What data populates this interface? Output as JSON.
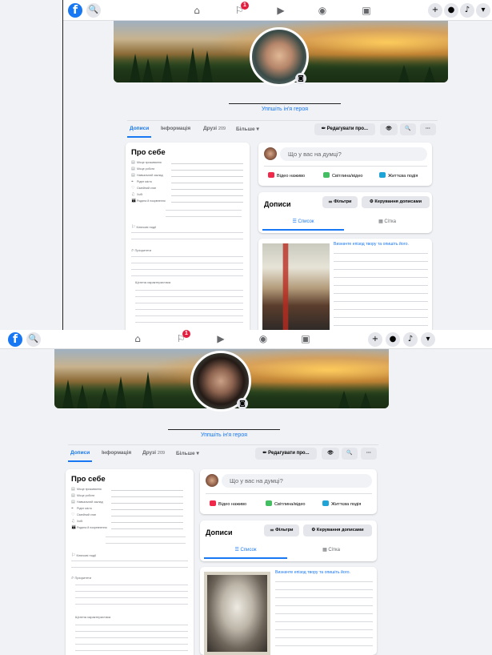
{
  "topbar": {
    "logo_letter": "f",
    "search_icon": "🔍",
    "notifications_badge": "1"
  },
  "profile": {
    "hero_name_link": "Уппшіть ін'я героя"
  },
  "tabs": {
    "posts": "Дописи",
    "info": "Інформація",
    "friends": "Друзі",
    "friends_count": "209",
    "more": "Більше ▾",
    "edit_profile": "✏ Редагувати про...",
    "view_icon": "👁",
    "search_icon": "🔍",
    "more_icon": "···"
  },
  "about": {
    "title": "Про себе",
    "rows": [
      {
        "icon": "▤",
        "label": "Місце проживання"
      },
      {
        "icon": "▤",
        "label": "Місце роботи"
      },
      {
        "icon": "▤",
        "label": "Навчальний заклад"
      },
      {
        "icon": "⌖",
        "label": "Рідне місто"
      },
      {
        "icon": "♡",
        "label": "Сімейний стан"
      },
      {
        "icon": "♫",
        "label": "Хобі"
      },
      {
        "icon": "👪",
        "label": "Родина й покрвнення"
      }
    ],
    "life_events": "Ключові події",
    "preferences": "Пріоритети",
    "character_traits": "Щтатна характеристика",
    "life_events_p2": "Ключові події",
    "preferences_p2": "Пріоритети",
    "character_traits_p2": "Щтатна характеристика",
    "rows_p2": [
      {
        "icon": "▤",
        "label": "Місце проживання"
      },
      {
        "icon": "▤",
        "label": "Місце роботи"
      },
      {
        "icon": "▤",
        "label": "Навчальний заклад"
      },
      {
        "icon": "⌖",
        "label": "Рідне місто"
      },
      {
        "icon": "♡",
        "label": "Сімейний стан"
      },
      {
        "icon": "♫",
        "label": "Хобі"
      },
      {
        "icon": "👪",
        "label": "Родина й покревнення"
      }
    ]
  },
  "composer": {
    "placeholder": "Що у вас на думці?",
    "live_video": "Відео наживо",
    "photo_video": "Світлина/відео",
    "life_event": "Життєва подія"
  },
  "posts": {
    "title": "Дописи",
    "filters": "⚌ Фільтри",
    "manage": "⚙ Керування дописами",
    "list_view": "☰ Список",
    "grid_view": "▦ Сітка",
    "post_link_1": "Визначте епізод твору та опишіть його.",
    "post_link_2": "Визначте епізод твору та опишіть його."
  }
}
